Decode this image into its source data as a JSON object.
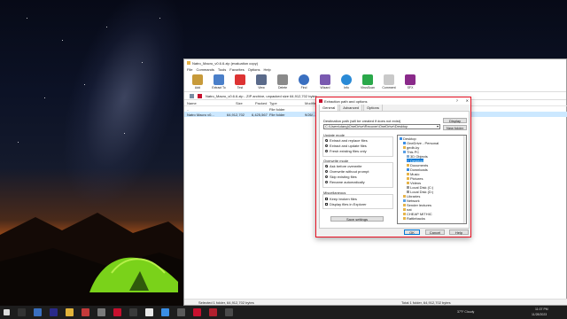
{
  "window": {
    "title": "Natro_Macro_v0.6.6.zip (evaluation copy)",
    "menu": [
      "File",
      "Commands",
      "Tools",
      "Favorites",
      "Options",
      "Help"
    ],
    "toolbar": [
      "Add",
      "Extract To",
      "Test",
      "View",
      "Delete",
      "Find",
      "Wizard",
      "Info",
      "VirusScan",
      "Comment",
      "SFX"
    ],
    "path": "Natro_Macro_v0.6.6.zip - ZIP archive, unpacked size 64,912,702 bytes",
    "columns": [
      "Name",
      "Size",
      "Packed",
      "Type",
      "Modified"
    ],
    "rows": [
      {
        "name": "..",
        "size": "",
        "packed": "",
        "type": "File folder",
        "modified": ""
      },
      {
        "name": "Natro Macro v0...",
        "size": "64,912,702",
        "packed": "6,425,567",
        "type": "File folder",
        "modified": "9/26/..."
      }
    ],
    "status_left": "Selected 1 folder, 64,912,702 bytes",
    "status_right": "Total 1 folder, 64,912,702 bytes"
  },
  "dialog": {
    "title": "Extraction path and options",
    "help": "?",
    "close": "✕",
    "tabs": [
      "General",
      "Advanced",
      "Options"
    ],
    "dest_label": "Destination path (will be created if does not exist)",
    "dest_value": "C:\\Users\\dang\\OneDrive\\Recover\\OneDrive\\Desktop",
    "display_button": "Display",
    "new_folder_button": "New folder",
    "update_mode_label": "Update mode",
    "update_options": [
      "Extract and replace files",
      "Extract and update files",
      "Fresh existing files only"
    ],
    "overwrite_label": "Overwrite mode",
    "overwrite_options": [
      "Ask before overwrite",
      "Overwrite without prompt",
      "Skip existing files",
      "Rename automatically"
    ],
    "misc_label": "Miscellaneous",
    "misc_options": [
      "Keep broken files",
      "Display files in Explorer"
    ],
    "save_settings": "Save settings",
    "tree": [
      "Desktop",
      "OneDrive - Personal",
      "gedb-ky",
      "This PC",
      "3D Objects",
      "Desktop",
      "Documents",
      "Downloads",
      "Music",
      "Pictures",
      "Videos",
      "Local Disk (C:)",
      "Local Disk (D:)",
      "Libraries",
      "Network",
      "Sender lectures",
      "nat",
      "CHEAP MITHIC",
      "Rattlebacks"
    ],
    "ok": "OK",
    "cancel": "Cancel",
    "help_button": "Help"
  },
  "taskbar": {
    "weather": "37°F  Cloudy",
    "time": "11:07 PM",
    "date": "11/28/2023"
  },
  "colors": {
    "accent": "#0078d7",
    "dialog_border": "#e81123",
    "tent": "#7ad21a"
  }
}
